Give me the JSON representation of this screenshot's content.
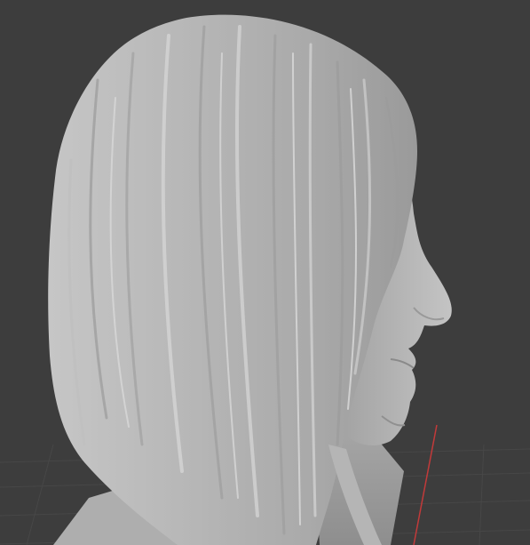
{
  "viewport": {
    "background": "#3d3d3d",
    "grid_color": "#474747",
    "x_axis_color": "#c23a3a"
  },
  "model": {
    "material_color": "#b9b9b9",
    "shadow_color": "#8f8f8f",
    "highlight_color": "#d6d6d6"
  }
}
